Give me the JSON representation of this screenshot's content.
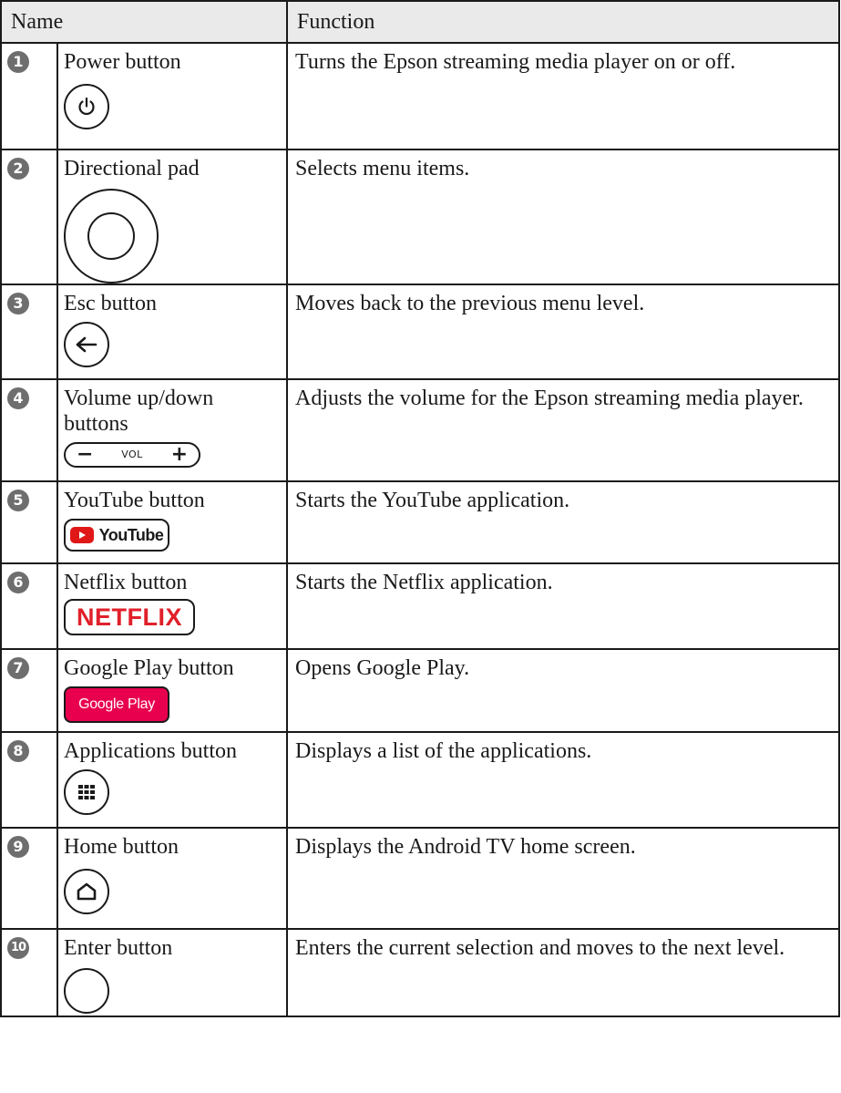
{
  "header": {
    "name": "Name",
    "function": "Function"
  },
  "rows": [
    {
      "num": "1",
      "name": "Power button",
      "function": "Turns the Epson streaming media player on or off.",
      "icon": "power-icon"
    },
    {
      "num": "2",
      "name": "Directional pad",
      "function": "Selects menu items.",
      "icon": "directional-pad-icon"
    },
    {
      "num": "3",
      "name": "Esc button",
      "function": "Moves back to the previous menu level.",
      "icon": "back-arrow-icon"
    },
    {
      "num": "4",
      "name": "Volume up/down buttons",
      "function": "Adjusts the volume for the Epson streaming media player.",
      "icon": "volume-rocker-icon",
      "icon_text": "VOL"
    },
    {
      "num": "5",
      "name": "YouTube button",
      "function": "Starts the YouTube application.",
      "icon": "youtube-logo-icon",
      "icon_text": "YouTube"
    },
    {
      "num": "6",
      "name": "Netflix button",
      "function": "Starts the Netflix application.",
      "icon": "netflix-logo-icon",
      "icon_text": "NETFLIX"
    },
    {
      "num": "7",
      "name": "Google Play button",
      "function": "Opens Google Play.",
      "icon": "google-play-logo-icon",
      "icon_text": "Google Play"
    },
    {
      "num": "8",
      "name": "Applications button",
      "function": "Displays a list of the applications.",
      "icon": "apps-grid-icon"
    },
    {
      "num": "9",
      "name": "Home button",
      "function": "Displays the Android TV home screen.",
      "icon": "home-icon"
    },
    {
      "num": "10",
      "name": "Enter button",
      "function": "Enters the current selection and moves to the next level.",
      "icon": "enter-circle-icon"
    }
  ],
  "colors": {
    "badge": "#6e6e6e",
    "header_bg": "#eaeaea",
    "youtube_red": "#e01717",
    "netflix_red": "#e0202a",
    "google_play_pink": "#e8004f"
  }
}
